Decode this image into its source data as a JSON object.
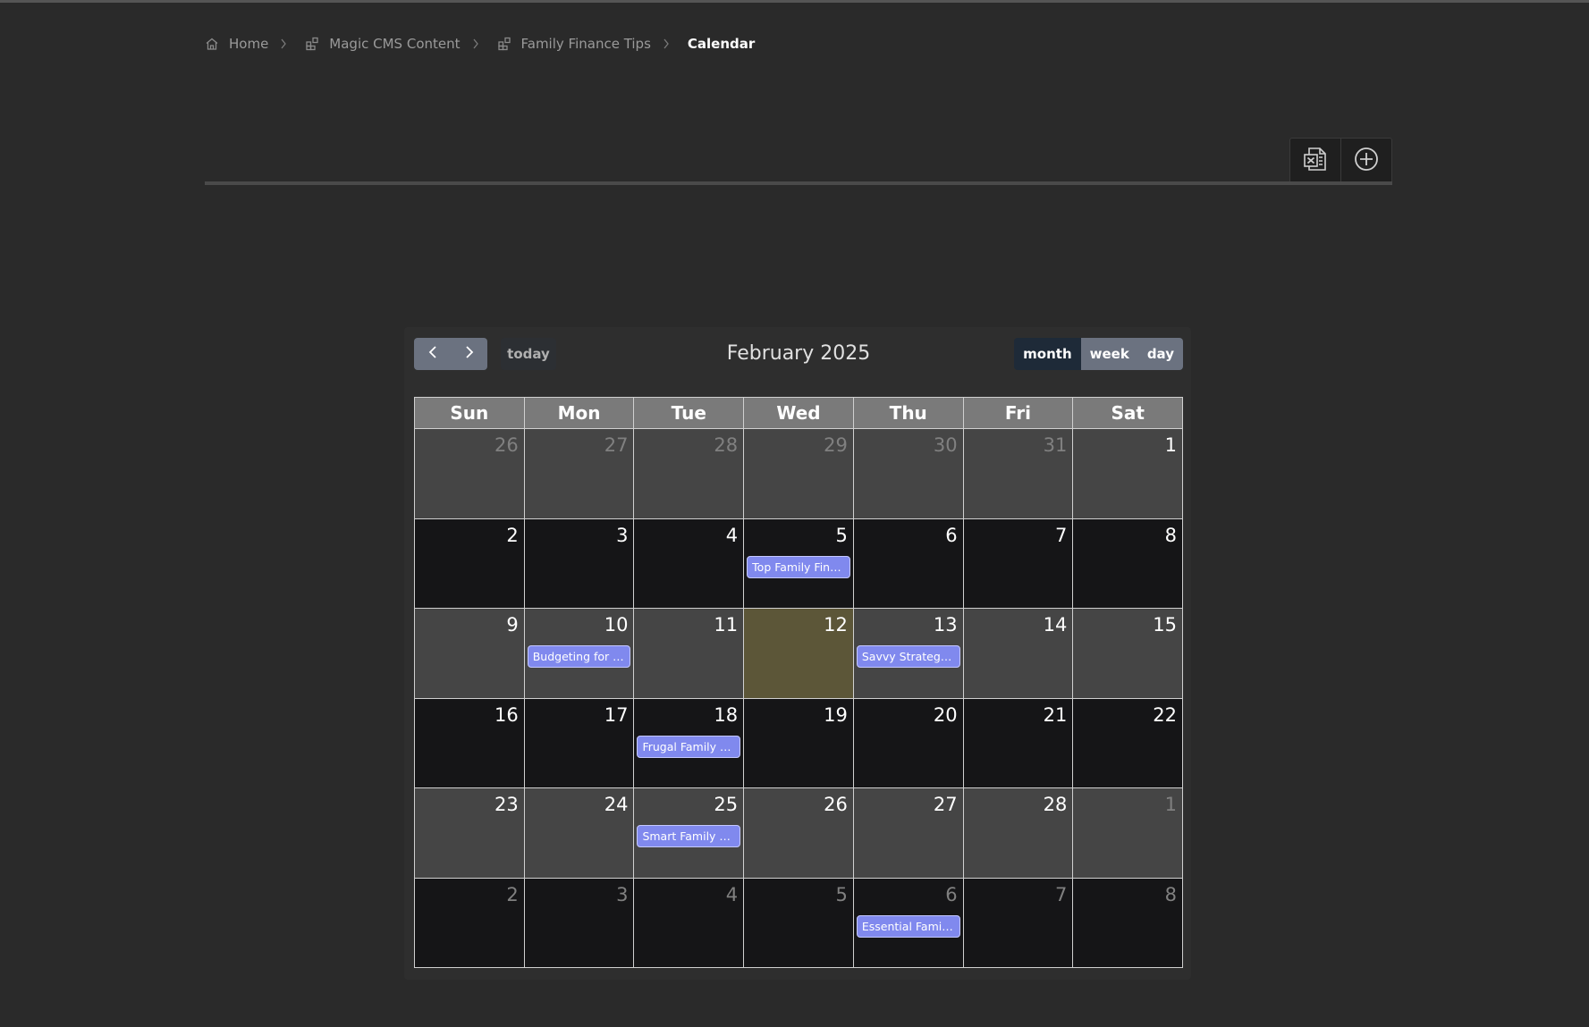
{
  "breadcrumb": {
    "items": [
      {
        "label": "Home",
        "icon": "home-icon"
      },
      {
        "label": "Magic CMS Content",
        "icon": "blocks-icon"
      },
      {
        "label": "Family Finance Tips",
        "icon": "blocks-icon"
      },
      {
        "label": "Calendar"
      }
    ]
  },
  "toolbar": {
    "export_icon": "excel-icon",
    "add_icon": "plus-circle-icon"
  },
  "calendar": {
    "title": "February 2025",
    "today_label": "today",
    "views": {
      "month": "month",
      "week": "week",
      "day": "day"
    },
    "active_view": "month",
    "days_of_week": [
      "Sun",
      "Mon",
      "Tue",
      "Wed",
      "Thu",
      "Fri",
      "Sat"
    ],
    "weeks": [
      [
        {
          "n": "26",
          "other": true
        },
        {
          "n": "27",
          "other": true
        },
        {
          "n": "28",
          "other": true
        },
        {
          "n": "29",
          "other": true
        },
        {
          "n": "30",
          "other": true
        },
        {
          "n": "31",
          "other": true
        },
        {
          "n": "1"
        }
      ],
      [
        {
          "n": "2"
        },
        {
          "n": "3"
        },
        {
          "n": "4"
        },
        {
          "n": "5",
          "event": "Top Family Financ..."
        },
        {
          "n": "6"
        },
        {
          "n": "7"
        },
        {
          "n": "8"
        }
      ],
      [
        {
          "n": "9"
        },
        {
          "n": "10",
          "event": "Budgeting for Fa..."
        },
        {
          "n": "11"
        },
        {
          "n": "12",
          "today": true
        },
        {
          "n": "13",
          "event": "Savvy Strategies ..."
        },
        {
          "n": "14"
        },
        {
          "n": "15"
        }
      ],
      [
        {
          "n": "16"
        },
        {
          "n": "17"
        },
        {
          "n": "18",
          "event": "Frugal Family Livi..."
        },
        {
          "n": "19"
        },
        {
          "n": "20"
        },
        {
          "n": "21"
        },
        {
          "n": "22"
        }
      ],
      [
        {
          "n": "23"
        },
        {
          "n": "24"
        },
        {
          "n": "25",
          "event": "Smart Family Fin..."
        },
        {
          "n": "26"
        },
        {
          "n": "27"
        },
        {
          "n": "28"
        },
        {
          "n": "1",
          "other": true
        }
      ],
      [
        {
          "n": "2",
          "other": true
        },
        {
          "n": "3",
          "other": true
        },
        {
          "n": "4",
          "other": true
        },
        {
          "n": "5",
          "other": true
        },
        {
          "n": "6",
          "other": true,
          "event": "Essential Family F..."
        },
        {
          "n": "7",
          "other": true
        },
        {
          "n": "8",
          "other": true
        }
      ]
    ]
  },
  "colors": {
    "event_bg": "#8089ee",
    "today_bg": "#5c5638",
    "active_view_bg": "#1e2a38"
  }
}
